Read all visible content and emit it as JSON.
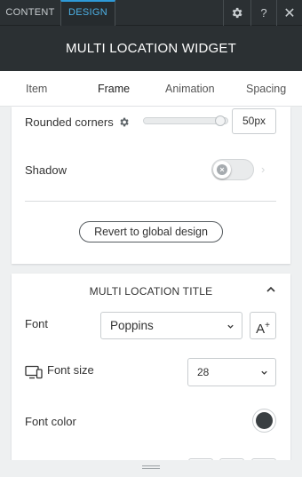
{
  "top_tabs": {
    "content": "CONTENT",
    "design": "DESIGN"
  },
  "toolbar": {
    "gear_icon": "gear-icon",
    "help": "?",
    "close": "✕"
  },
  "header": {
    "title": "MULTI LOCATION WIDGET"
  },
  "sub_tabs": [
    {
      "label": "Item"
    },
    {
      "label": "Frame",
      "active": true
    },
    {
      "label": "Animation"
    },
    {
      "label": "Spacing"
    }
  ],
  "frame": {
    "rounded_corners": {
      "label": "Rounded corners",
      "value": "50px",
      "slider_fraction": 0.92
    },
    "shadow": {
      "label": "Shadow",
      "enabled": false
    },
    "revert_label": "Revert to global design"
  },
  "title_section": {
    "heading": "MULTI LOCATION TITLE",
    "font": {
      "label": "Font",
      "value": "Poppins",
      "add_label": "A",
      "add_plus": "+"
    },
    "font_size": {
      "label": "Font size",
      "value": "28"
    },
    "font_color": {
      "label": "Font color",
      "color": "#3a3f42"
    }
  },
  "colors": {
    "accent": "#2e9ad8",
    "dark_header": "#2b3033"
  }
}
